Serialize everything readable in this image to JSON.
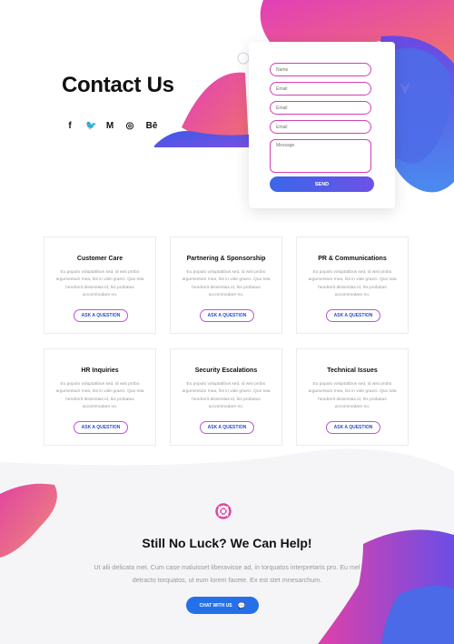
{
  "hero": {
    "title": "Contact Us",
    "social_icons": [
      "facebook-icon",
      "twitter-icon",
      "medium-icon",
      "dribbble-icon",
      "behance-icon"
    ],
    "social_glyphs": [
      "f",
      "🐦",
      "M",
      "◎",
      "Bē"
    ]
  },
  "form": {
    "name_placeholder": "Name",
    "email1_placeholder": "Email",
    "email2_placeholder": "Email",
    "email3_placeholder": "Email",
    "message_placeholder": "Message",
    "send_label": "SEND"
  },
  "cards": [
    {
      "title": "Customer Care",
      "body": "Eu populo voluptatibus sed, id wisi probo argumentum mea, his in vide graeci. Quo tota hendrerit dissentias id, his probatus accommodare no.",
      "button": "ASK A QUESTION"
    },
    {
      "title": "Partnering & Sponsorship",
      "body": "Eu populo voluptatibus sed, id wisi probo argumentum mea, his in vide graeci. Quo tota hendrerit dissentias id, his probatus accommodare no.",
      "button": "ASK A QUESTION"
    },
    {
      "title": "PR & Communications",
      "body": "Eu populo voluptatibus sed, id wisi probo argumentum mea, his in vide graeci. Quo tota hendrerit dissentias id, his probatus accommodare no.",
      "button": "ASK A QUESTION"
    },
    {
      "title": "HR Inquiries",
      "body": "Eu populo voluptatibus sed, id wisi probo argumentum mea, his in vide graeci. Quo tota hendrerit dissentias id, his probatus accommodare no.",
      "button": "ASK A QUESTION"
    },
    {
      "title": "Security Escalations",
      "body": "Eu populo voluptatibus sed, id wisi probo argumentum mea, his in vide graeci. Quo tota hendrerit dissentias id, his probatus accommodare no.",
      "button": "ASK A QUESTION"
    },
    {
      "title": "Technical Issues",
      "body": "Eu populo voluptatibus sed, id wisi probo argumentum mea, his in vide graeci. Quo tota hendrerit dissentias id, his probatus accommodare no.",
      "button": "ASK A QUESTION"
    }
  ],
  "help": {
    "title": "Still No Luck? We Can Help!",
    "line1": "Ut alii delicata mei. Cum case maluisset liberavisse ad, in torquatos interpretaris pro. Eu mel",
    "line2": "detracto torquatos, ut eum lorem facete. Ex est stet mnesarchum.",
    "chat_label": "CHAT WITH US"
  },
  "colors": {
    "accent_blue": "#2570e8",
    "accent_pink": "#d43fb3",
    "blob_purple": "#5a50e6"
  }
}
